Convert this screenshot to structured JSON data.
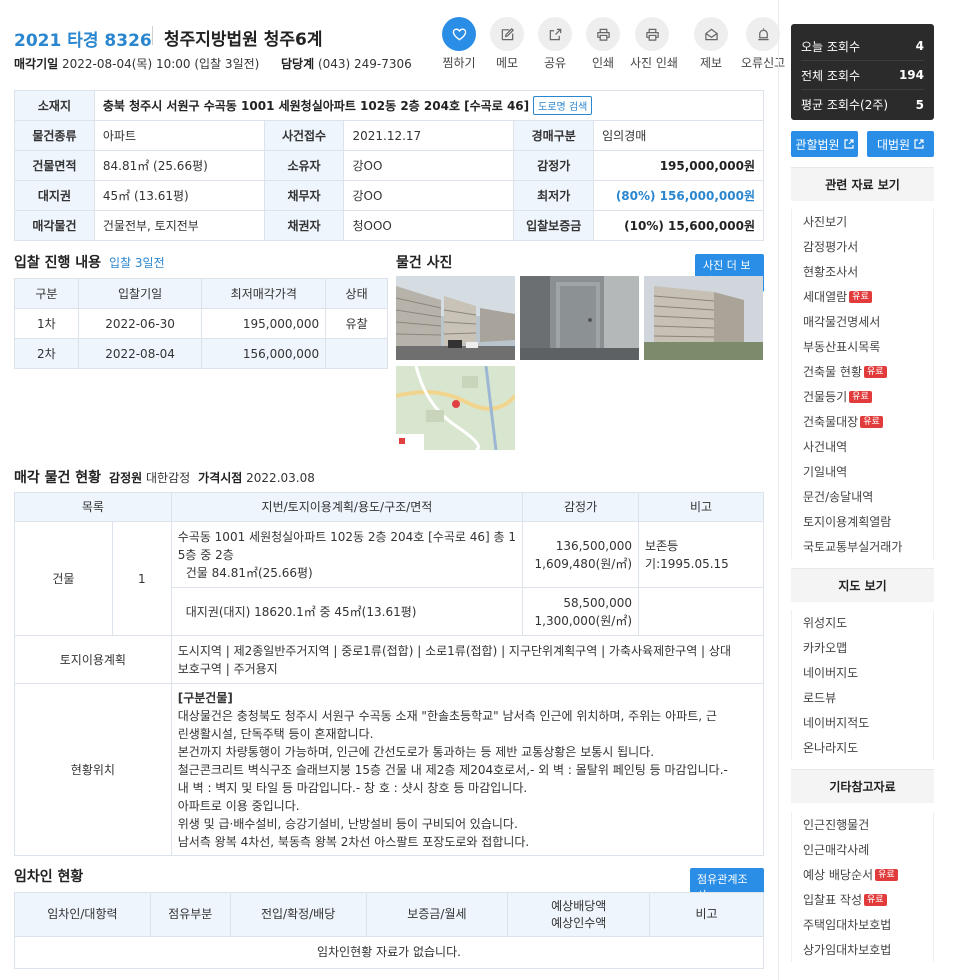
{
  "header": {
    "case_no": "2021 타경 8326",
    "court": "청주지방법원 청주6계",
    "sale_date_label": "매각기일",
    "sale_date": "2022-08-04(목) 10:00 (입찰 3일전)",
    "dept_label": "담당계",
    "dept_phone": "(043) 249-7306"
  },
  "actions": [
    {
      "label": "찜하기",
      "icon": "heart-icon"
    },
    {
      "label": "메모",
      "icon": "memo-icon"
    },
    {
      "label": "공유",
      "icon": "share-icon"
    },
    {
      "label": "인쇄",
      "icon": "print-icon"
    },
    {
      "label": "사진 인쇄",
      "icon": "photo-print-icon"
    },
    {
      "label": "제보",
      "icon": "report-icon"
    },
    {
      "label": "오류신고",
      "icon": "alert-icon"
    }
  ],
  "info": {
    "address_label": "소재지",
    "address": "충북 청주시 서원구 수곡동 1001 세원청실아파트 102동 2층 204호 [수곡로 46]",
    "road_search": "도로명 검색",
    "rows": [
      [
        {
          "k": "물건종류",
          "v": "아파트"
        },
        {
          "k": "사건접수",
          "v": "2021.12.17"
        },
        {
          "k": "경매구분",
          "v": "임의경매"
        }
      ],
      [
        {
          "k": "건물면적",
          "v": "84.81㎡ (25.66평)"
        },
        {
          "k": "소유자",
          "v": "강OO"
        },
        {
          "k": "감정가",
          "v": "195,000,000원"
        }
      ],
      [
        {
          "k": "대지권",
          "v": "45㎡ (13.61평)"
        },
        {
          "k": "채무자",
          "v": "강OO"
        },
        {
          "k": "최저가",
          "v": "(80%) 156,000,000원"
        }
      ],
      [
        {
          "k": "매각물건",
          "v": "건물전부, 토지전부"
        },
        {
          "k": "채권자",
          "v": "청OOO"
        },
        {
          "k": "입찰보증금",
          "v": "(10%) 15,600,000원"
        }
      ]
    ]
  },
  "bid": {
    "title": "입찰 진행 내용",
    "sub": "입찰 3일전",
    "headers": [
      "구분",
      "입찰기일",
      "최저매각가격",
      "상태"
    ],
    "rows": [
      [
        "1차",
        "2022-06-30",
        "195,000,000",
        "유찰"
      ],
      [
        "2차",
        "2022-08-04",
        "156,000,000",
        ""
      ]
    ]
  },
  "photos": {
    "title": "물건 사진",
    "more": "사진 더 보기"
  },
  "goods": {
    "title": "매각 물건 현황",
    "appraiser_label": "감정원",
    "appraiser": "대한감정",
    "price_date_label": "가격시점",
    "price_date": "2022.03.08",
    "headers": [
      "목록",
      "지번/토지이용계획/용도/구조/면적",
      "감정가",
      "비고"
    ],
    "building_label": "건물",
    "building_no": "1",
    "b1_line1": "수곡동 1001 세원청실아파트 102동 2층 204호 [수곡로 46] 총 1",
    "b1_line2": "5층 중 2층",
    "b1_line3": "건물 84.81㎡(25.66평)",
    "b1_price1": "136,500,000",
    "b1_price2": "1,609,480(원/㎡)",
    "b1_note": "보존등기:1995.05.15",
    "b2_desc": "대지권(대지) 18620.1㎡ 중 45㎡(13.61평)",
    "b2_price1": "58,500,000",
    "b2_price2": "1,300,000(원/㎡)",
    "land_label": "토지이용계획",
    "land_line1": "도시지역 | 제2종일반주거지역 | 중로1류(접합) | 소로1류(접합) | 지구단위계획구역 | 가축사육제한구역 | 상대",
    "land_line2": "보호구역 | 주거용지",
    "loc_label": "현황위치",
    "loc_lines": [
      "[구분건물]",
      "대상물건은 충청북도 청주시 서원구 수곡동 소재 \"한솔초등학교\" 남서측 인근에 위치하며, 주위는 아파트, 근",
      "린생활시설, 단독주택 등이 혼재합니다.",
      "본건까지 차량통행이 가능하며, 인근에 간선도로가 통과하는 등 제반 교통상황은 보통시 됩니다.",
      "철근콘크리트 벽식구조 슬래브지붕 15층 건물 내 제2층 제204호로서,- 외 벽 : 몰탈위 페인팅 등 마감입니다.-",
      "내 벽 : 벽지 및 타일 등 마감입니다.- 창 호 : 샷시 창호 등 마감입니다.",
      "아파트로 이용 중입니다.",
      "위생 및 급·배수설비, 승강기설비, 난방설비 등이 구비되어 있습니다.",
      "남서측 왕복 4차선, 북동측 왕복 2차선 아스팔트 포장도로와 접합니다."
    ]
  },
  "tenant": {
    "title": "임차인 현황",
    "btn": "점유관계조사",
    "h1": "임차인/대항력",
    "h2": "점유부분",
    "h3": "전입/확정/배당",
    "h4": "보증금/월세",
    "h5a": "예상배당액",
    "h5b": "예상인수액",
    "h6": "비고",
    "empty": "임차인현황 자료가 없습니다."
  },
  "sidebar": {
    "stats": [
      {
        "label": "오늘 조회수",
        "value": "4"
      },
      {
        "label": "전체 조회수",
        "value": "194"
      },
      {
        "label": "평균 조회수(2주)",
        "value": "5"
      }
    ],
    "court_btn": "관할법원",
    "supreme_btn": "대법원",
    "badge": "유료",
    "ref_title": "관련 자료 보기",
    "ref_items": [
      {
        "label": "사진보기",
        "paid": false
      },
      {
        "label": "감정평가서",
        "paid": false
      },
      {
        "label": "현황조사서",
        "paid": false
      },
      {
        "label": "세대열람",
        "paid": true
      },
      {
        "label": "매각물건명세서",
        "paid": false
      },
      {
        "label": "부동산표시목록",
        "paid": false
      },
      {
        "label": "건축물 현황",
        "paid": true
      },
      {
        "label": "건물등기",
        "paid": true
      },
      {
        "label": "건축물대장",
        "paid": true
      },
      {
        "label": "사건내역",
        "paid": false
      },
      {
        "label": "기일내역",
        "paid": false
      },
      {
        "label": "문건/송달내역",
        "paid": false
      },
      {
        "label": "토지이용계획열람",
        "paid": false
      },
      {
        "label": "국토교통부실거래가",
        "paid": false
      }
    ],
    "map_title": "지도 보기",
    "map_items": [
      "위성지도",
      "카카오맵",
      "네이버지도",
      "로드뷰",
      "네이버지적도",
      "온나라지도"
    ],
    "etc_title": "기타참고자료",
    "etc_items": [
      {
        "label": "인근진행물건",
        "paid": false
      },
      {
        "label": "인근매각사례",
        "paid": false
      },
      {
        "label": "예상 배당순서",
        "paid": true
      },
      {
        "label": "입찰표 작성",
        "paid": true
      },
      {
        "label": "주택임대차보호법",
        "paid": false
      },
      {
        "label": "상가임대차보호법",
        "paid": false
      }
    ]
  }
}
